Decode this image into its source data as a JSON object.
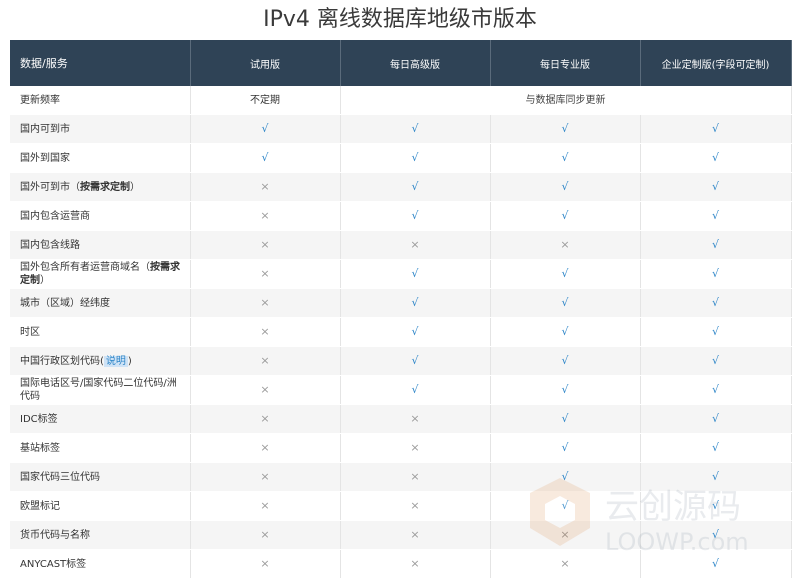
{
  "title": "IPv4 离线数据库地级市版本",
  "columns": [
    "数据/服务",
    "试用版",
    "每日高级版",
    "每日专业版",
    "企业定制版(字段可定制)"
  ],
  "freq_row": {
    "label": "更新频率",
    "trial": "不定期",
    "others": "与数据库同步更新"
  },
  "rows": [
    {
      "label": "国内可到市",
      "v": [
        1,
        1,
        1,
        1
      ]
    },
    {
      "label": "国外到国家",
      "v": [
        1,
        1,
        1,
        1
      ]
    },
    {
      "label": "国外可到市（",
      "bold": "按需求定制",
      "suffix": "）",
      "v": [
        0,
        1,
        1,
        1
      ]
    },
    {
      "label": "国内包含运营商",
      "v": [
        0,
        1,
        1,
        1
      ]
    },
    {
      "label": "国内包含线路",
      "v": [
        0,
        0,
        0,
        1
      ]
    },
    {
      "label": "国外包含所有者运营商域名（",
      "bold": "按需求定制",
      "suffix": "）",
      "v": [
        0,
        1,
        1,
        1
      ]
    },
    {
      "label": "城市（区域）经纬度",
      "v": [
        0,
        1,
        1,
        1
      ]
    },
    {
      "label": "时区",
      "v": [
        0,
        1,
        1,
        1
      ]
    },
    {
      "label": "中国行政区划代码(",
      "link": "说明",
      "suffix": ")",
      "v": [
        0,
        1,
        1,
        1
      ]
    },
    {
      "label": "国际电话区号/国家代码二位代码/洲代码",
      "v": [
        0,
        1,
        1,
        1
      ]
    },
    {
      "label": "IDC标签",
      "v": [
        0,
        0,
        1,
        1
      ]
    },
    {
      "label": "基站标签",
      "v": [
        0,
        0,
        1,
        1
      ]
    },
    {
      "label": "国家代码三位代码",
      "v": [
        0,
        0,
        1,
        1
      ]
    },
    {
      "label": "欧盟标记",
      "v": [
        0,
        0,
        1,
        1
      ]
    },
    {
      "label": "货币代码与名称",
      "v": [
        0,
        0,
        0,
        1
      ]
    },
    {
      "label": "ANYCAST标签",
      "v": [
        0,
        0,
        0,
        1
      ]
    }
  ],
  "marks": {
    "yes": "√",
    "no": "×"
  },
  "watermark": {
    "line1": "云创源码",
    "line2": "LOOWP.com"
  }
}
